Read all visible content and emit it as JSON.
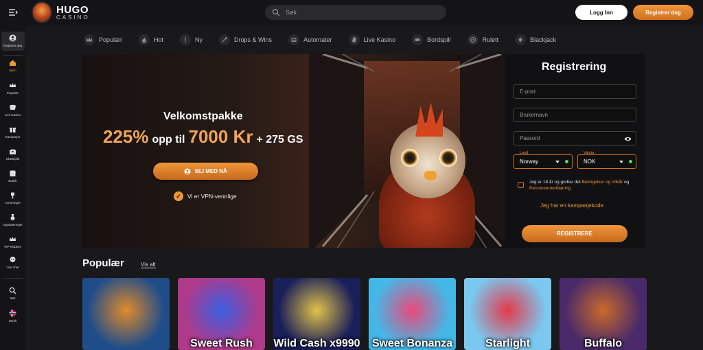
{
  "header": {
    "logo_top": "HUGO",
    "logo_bottom": "CASINO",
    "search_placeholder": "Søk",
    "login_label": "Logg Inn",
    "register_label": "Registrer deg"
  },
  "sidebar": {
    "items": [
      {
        "label": "Registrer deg",
        "icon": "user-icon"
      },
      {
        "label": "Hjem",
        "icon": "home-icon"
      },
      {
        "label": "Populær",
        "icon": "crown-icon"
      },
      {
        "label": "Live Kasino",
        "icon": "cards-icon"
      },
      {
        "label": "Kampanjer",
        "icon": "gift-icon"
      },
      {
        "label": "Skattejakt",
        "icon": "chest-icon"
      },
      {
        "label": "Butikk",
        "icon": "shop-icon"
      },
      {
        "label": "Turneringer",
        "icon": "trophy-icon"
      },
      {
        "label": "Oppdrag",
        "icon": "medal-icon"
      },
      {
        "label": "Oppdateringer",
        "icon": "update-icon"
      },
      {
        "label": "VIP-Klubben",
        "icon": "vip-crown-icon"
      },
      {
        "label": "Live chat",
        "icon": "chat-icon"
      },
      {
        "label": "Søk",
        "icon": "search-icon"
      },
      {
        "label": "Norsk",
        "icon": "norway-flag-icon"
      }
    ]
  },
  "categories": [
    {
      "label": "Populær",
      "icon": "crown-icon"
    },
    {
      "label": "Hot",
      "icon": "fire-icon"
    },
    {
      "label": "Ny",
      "icon": "new-icon"
    },
    {
      "label": "Drops & Wins",
      "icon": "drops-icon"
    },
    {
      "label": "Automater",
      "icon": "slot-icon"
    },
    {
      "label": "Live Kasino",
      "icon": "cards-icon"
    },
    {
      "label": "Bordspill",
      "icon": "table-icon"
    },
    {
      "label": "Rulett",
      "icon": "roulette-icon"
    },
    {
      "label": "Blackjack",
      "icon": "blackjack-icon"
    }
  ],
  "hero": {
    "title": "Velkomstpakke",
    "pct": "225%",
    "mid1": "opp til",
    "amount": "7000 Kr",
    "mid2": "+ 275 GS",
    "cta": "BLI MED NÅ",
    "vpn": "Vi er VPN-vennlige"
  },
  "registration": {
    "title": "Registrering",
    "email_placeholder": "E-post",
    "username_placeholder": "Brukernavn",
    "password_placeholder": "Passord",
    "country_label": "Land",
    "country_value": "Norway",
    "currency_label": "Valuta",
    "currency_value": "NOK",
    "terms_prefix": "Jeg er 18 år og godtar det",
    "terms_link1": "Betingelser og Vilkår",
    "terms_and": "og",
    "terms_link2": "Personvernerklæring",
    "promo_label": "Jeg har en kampanjekode",
    "submit_label": "REGISTRERE"
  },
  "popular": {
    "title": "Populær",
    "see_all": "Vis alt",
    "games": [
      {
        "name": "",
        "bg": "#1f4d8a",
        "accent": "#e08a2a"
      },
      {
        "name": "Sweet Rush",
        "bg": "#b03a8a",
        "accent": "#3b5ee0"
      },
      {
        "name": "Wild Cash x9990",
        "bg": "#1a1f5a",
        "accent": "#e0c24a"
      },
      {
        "name": "Sweet Bonanza",
        "bg": "#43b8e8",
        "accent": "#e94a7a"
      },
      {
        "name": "Starlight",
        "bg": "#7ac8f0",
        "accent": "#e43a4a"
      },
      {
        "name": "Buffalo",
        "bg": "#4a2a6a",
        "accent": "#c96a2a"
      }
    ]
  }
}
